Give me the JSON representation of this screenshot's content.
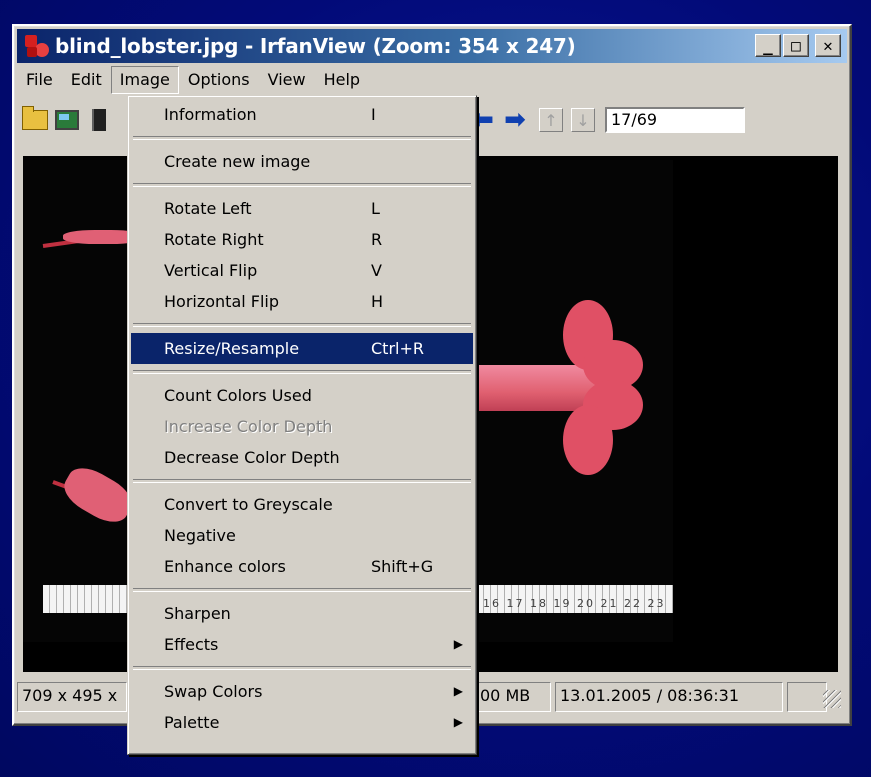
{
  "window": {
    "title": "blind_lobster.jpg - IrfanView (Zoom: 354 x 247)",
    "minimize": "_",
    "maximize": "□",
    "close": "✕"
  },
  "menubar": {
    "items": [
      "File",
      "Edit",
      "Image",
      "Options",
      "View",
      "Help"
    ],
    "active": "Image"
  },
  "toolbar": {
    "page_indicator": "17/69",
    "up": "↑",
    "down": "↓",
    "prev": "⬅",
    "next": "➡"
  },
  "image_menu": {
    "items": [
      {
        "label": "Information",
        "shortcut": "I"
      },
      {
        "label": "Create new image"
      },
      {
        "label": "Rotate Left",
        "shortcut": "L"
      },
      {
        "label": "Rotate Right",
        "shortcut": "R"
      },
      {
        "label": "Vertical Flip",
        "shortcut": "V"
      },
      {
        "label": "Horizontal Flip",
        "shortcut": "H"
      },
      {
        "label": "Resize/Resample",
        "shortcut": "Ctrl+R",
        "highlighted": true
      },
      {
        "label": "Count Colors Used"
      },
      {
        "label": "Increase Color Depth",
        "disabled": true
      },
      {
        "label": "Decrease Color Depth"
      },
      {
        "label": "Convert to Greyscale"
      },
      {
        "label": "Negative"
      },
      {
        "label": "Enhance colors",
        "shortcut": "Shift+G"
      },
      {
        "label": "Sharpen"
      },
      {
        "label": "Effects",
        "submenu": "▶"
      },
      {
        "label": "Swap Colors",
        "submenu": "▶"
      },
      {
        "label": "Palette",
        "submenu": "▶"
      }
    ]
  },
  "ruler_numbers": "16  17  18  19  20  21  22  23",
  "statusbar": {
    "dimensions": "709 x 495 x",
    "memory": "00 MB",
    "datetime": "13.01.2005 / 08:36:31"
  },
  "colors": {
    "title_gradient_start": "#0a246a",
    "title_gradient_end": "#a6caf0",
    "menu_highlight": "#0a246a",
    "face": "#d4d0c8",
    "desktop": "#000c6e"
  }
}
